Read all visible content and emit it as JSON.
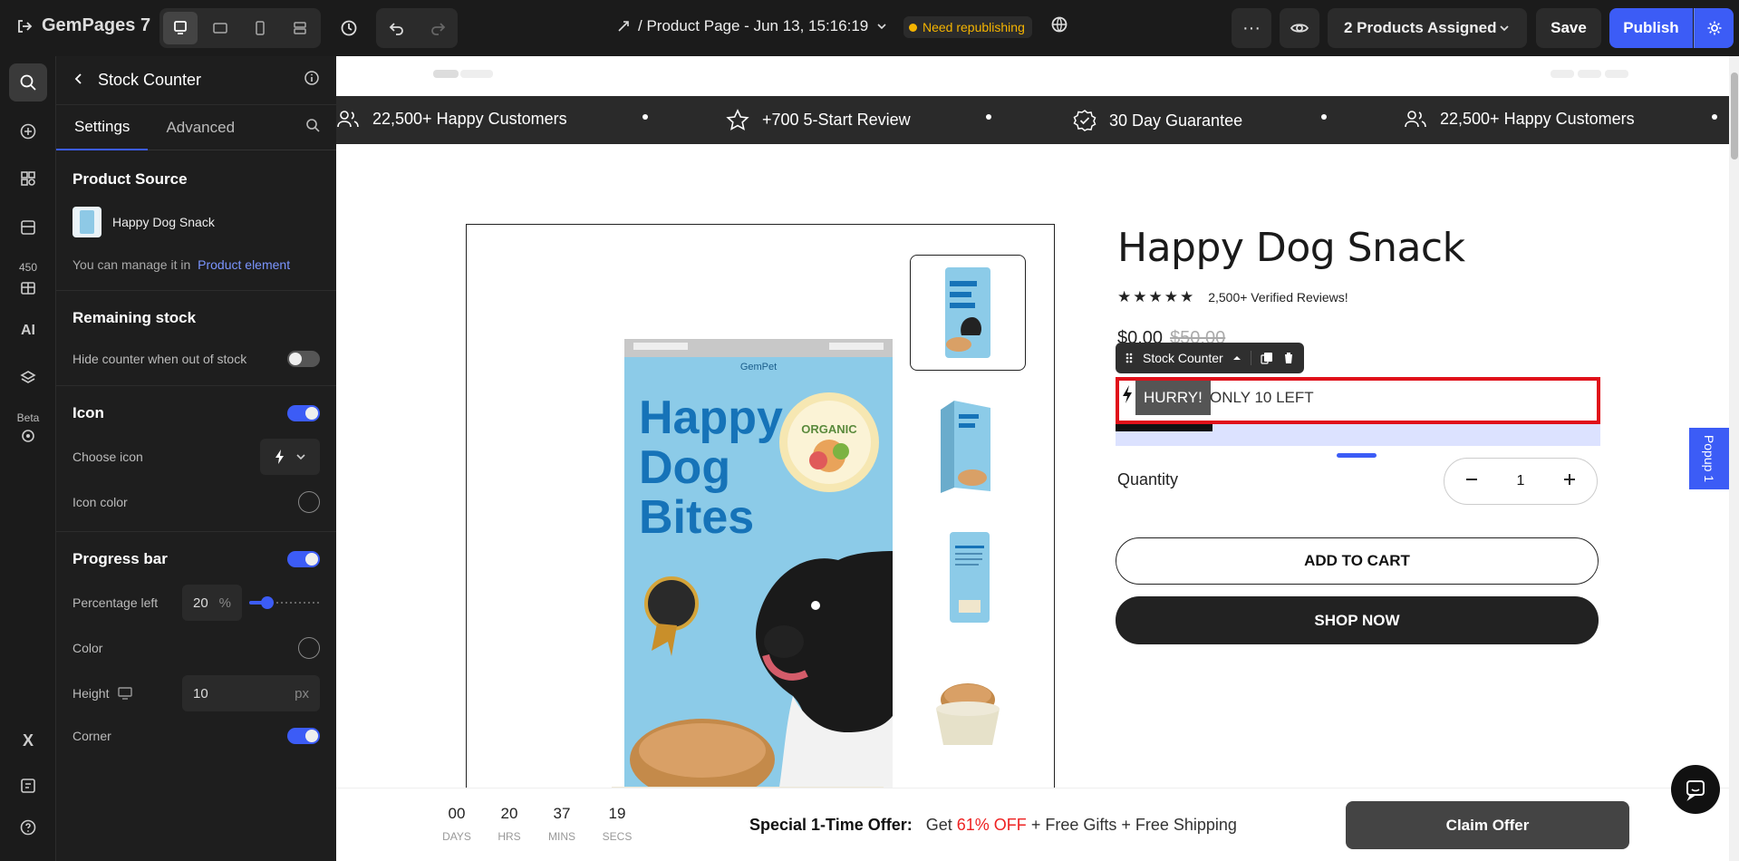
{
  "topbar": {
    "brand": "GemPages 7",
    "page_title": "/ Product Page - Jun 13, 15:16:19",
    "republish_badge": "Need republishing",
    "assigned": "2 Products Assigned",
    "save": "Save",
    "publish": "Publish"
  },
  "rail": {
    "badge_count": "450",
    "beta_label": "Beta"
  },
  "panel": {
    "title": "Stock Counter",
    "tabs": [
      "Settings",
      "Advanced"
    ],
    "product_source": {
      "title": "Product Source",
      "product_name": "Happy Dog Snack",
      "manage_text": "You can manage it in",
      "manage_link": "Product element"
    },
    "remaining_stock": {
      "title": "Remaining stock",
      "hide_label": "Hide counter when out of stock",
      "hide_on": false
    },
    "icon": {
      "title": "Icon",
      "enabled": true,
      "choose_label": "Choose icon",
      "color_label": "Icon color"
    },
    "progress": {
      "title": "Progress bar",
      "enabled": true,
      "percent_label": "Percentage left",
      "percent_value": "20",
      "percent_unit": "%",
      "slider_fraction": 0.2,
      "color_label": "Color",
      "height_label": "Height",
      "height_value": "10",
      "height_unit": "px",
      "corner_label": "Corner",
      "corner_on": true
    }
  },
  "canvas": {
    "banner": [
      "22,500+ Happy Customers",
      "+700 5-Start Review",
      "30 Day Guarantee",
      "22,500+ Happy Customers"
    ],
    "product": {
      "title": "Happy Dog Snack",
      "reviews": "2,500+ Verified Reviews!",
      "price": "$0.00",
      "old_price": "$50.00",
      "toolbar_label": "Stock Counter",
      "hurry": "HURRY!",
      "only_left": "ONLY 10 LEFT",
      "stock_fraction": 0.2,
      "quantity_label": "Quantity",
      "quantity_value": "1",
      "add_to_cart": "ADD TO CART",
      "shop_now": "SHOP NOW",
      "pack_text": [
        "Happy",
        "Dog",
        "Bites"
      ],
      "pack_brand": "GemPet",
      "pack_badge": "ORGANIC"
    },
    "popup_tab": "Popup 1",
    "sticky": {
      "countdown": [
        {
          "value": "00",
          "label": "DAYS"
        },
        {
          "value": "20",
          "label": "HRS"
        },
        {
          "value": "37",
          "label": "MINS"
        },
        {
          "value": "19",
          "label": "SECS"
        }
      ],
      "offer_bold": "Special 1-Time Offer:",
      "offer_get": "Get",
      "offer_discount": "61% OFF",
      "offer_rest": "+ Free Gifts + Free Shipping",
      "claim": "Claim Offer"
    }
  }
}
